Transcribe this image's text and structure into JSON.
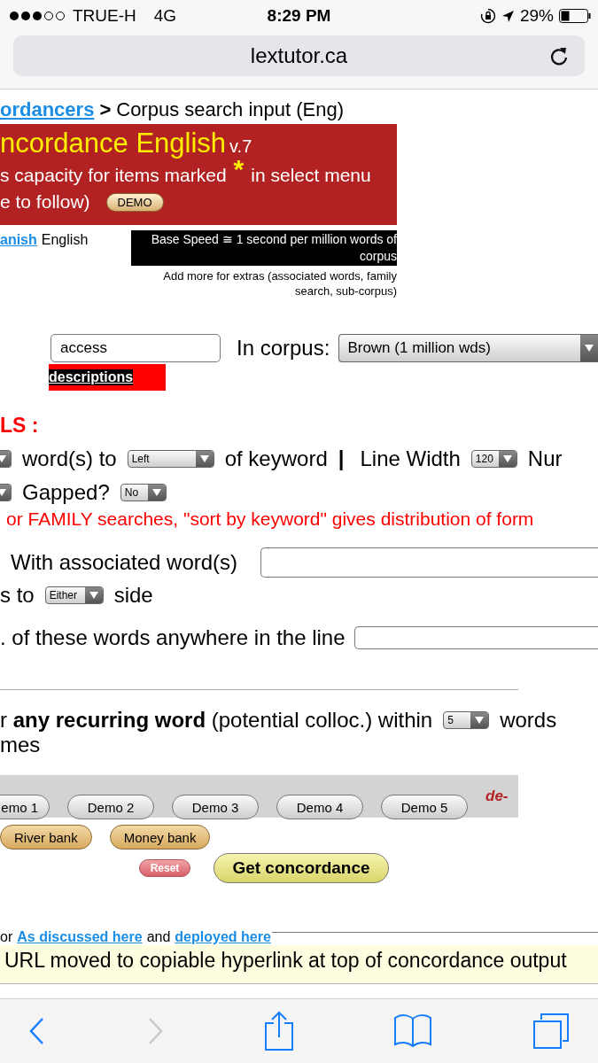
{
  "status_bar": {
    "carrier": "TRUE-H",
    "network": "4G",
    "time": "8:29 PM",
    "battery": "29%"
  },
  "address_bar": {
    "url": "lextutor.ca"
  },
  "breadcrumb": {
    "link": "ordancers",
    "separator": ">",
    "current": "Corpus search input (Eng)"
  },
  "banner": {
    "title": "ncordance English",
    "version": "v.7",
    "line_1a": "s capacity for items marked",
    "asterisk": "*",
    "line_1b": "in select menu",
    "line_2": "e to follow)",
    "demo_button": "DEMO"
  },
  "language": {
    "link": "anish",
    "current": "English"
  },
  "speed_note": "Base Speed ≅ 1 second per million words of corpus",
  "extras_note": "Add more for extras (associated words, family search, sub-corpus)",
  "search": {
    "value": "access",
    "corpus_label": "In corpus:",
    "corpus": "Brown (1 million wds)",
    "descriptions_link": "descriptions"
  },
  "section_heading": "LS :",
  "option_rows": [
    [
      {
        "kind": "select"
      },
      {
        "kind": "text",
        "text": "word(s) to"
      },
      {
        "kind": "wideselect",
        "value": "Left"
      },
      {
        "kind": "text",
        "text": "of keyword"
      },
      {
        "kind": "bar",
        "text": "|"
      },
      {
        "kind": "text",
        "text": "Line Width"
      },
      {
        "kind": "select",
        "value": "120"
      },
      {
        "kind": "text",
        "text": "Nur"
      }
    ],
    [
      {
        "kind": "select"
      },
      {
        "kind": "text",
        "text": "Gapped?"
      },
      {
        "kind": "select",
        "value": "No"
      }
    ]
  ],
  "family_note": "or FAMILY searches, \"sort by keyword\" gives distribution of form",
  "associated": {
    "label": "With associated word(s)",
    "side_prefix": "s to",
    "side": "Either",
    "side_suffix": "side"
  },
  "anywhere_label": ". of these words anywhere in the line",
  "recurring": {
    "text": "r **any recurring word** (potential colloc.) within",
    "within": "5",
    "suffix": "words",
    "line_2": "mes"
  },
  "demos": [
    "emo 1",
    "Demo 2",
    "Demo 3",
    "Demo 4",
    "Demo 5"
  ],
  "demo_note": "de-",
  "bank_buttons": [
    "River bank",
    "Money bank"
  ],
  "reset_button": "Reset",
  "submit_button": "Get concordance",
  "footer": {
    "prefix": "or",
    "link_1": "As discussed here",
    "middle": "and",
    "link_2": "deployed here",
    "notice": "URL moved to copiable hyperlink at top of concordance output"
  },
  "toolbar": {
    "back_enabled": true,
    "forward_enabled": false
  }
}
